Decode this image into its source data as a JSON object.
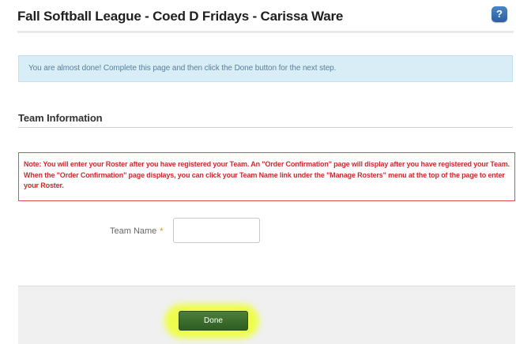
{
  "header": {
    "title": "Fall Softball League - Coed D Fridays - Carissa Ware",
    "help_label": "?"
  },
  "info": {
    "message": "You are almost done! Complete this page and then click the Done button for the next step."
  },
  "section": {
    "title": "Team Information"
  },
  "note": {
    "text": "Note: You will enter your Roster after you have registered your Team. An \"Order Confirmation\" page will display after you have registered your Team. When the \"Order Confirmation\" page displays, you can click your Team Name link under the \"Manage Rosters\" menu at the top of the page to enter your Roster."
  },
  "form": {
    "team_name_label": "Team Name",
    "required_marker": "*",
    "team_name_value": ""
  },
  "footer": {
    "done_label": "Done"
  },
  "colors": {
    "info_background": "#d9edf7",
    "note_border": "#e05050",
    "note_text": "#cc2a2a",
    "done_button": "#3d6e2e",
    "highlight": "#eeff3a",
    "help_button": "#3a72b5"
  }
}
